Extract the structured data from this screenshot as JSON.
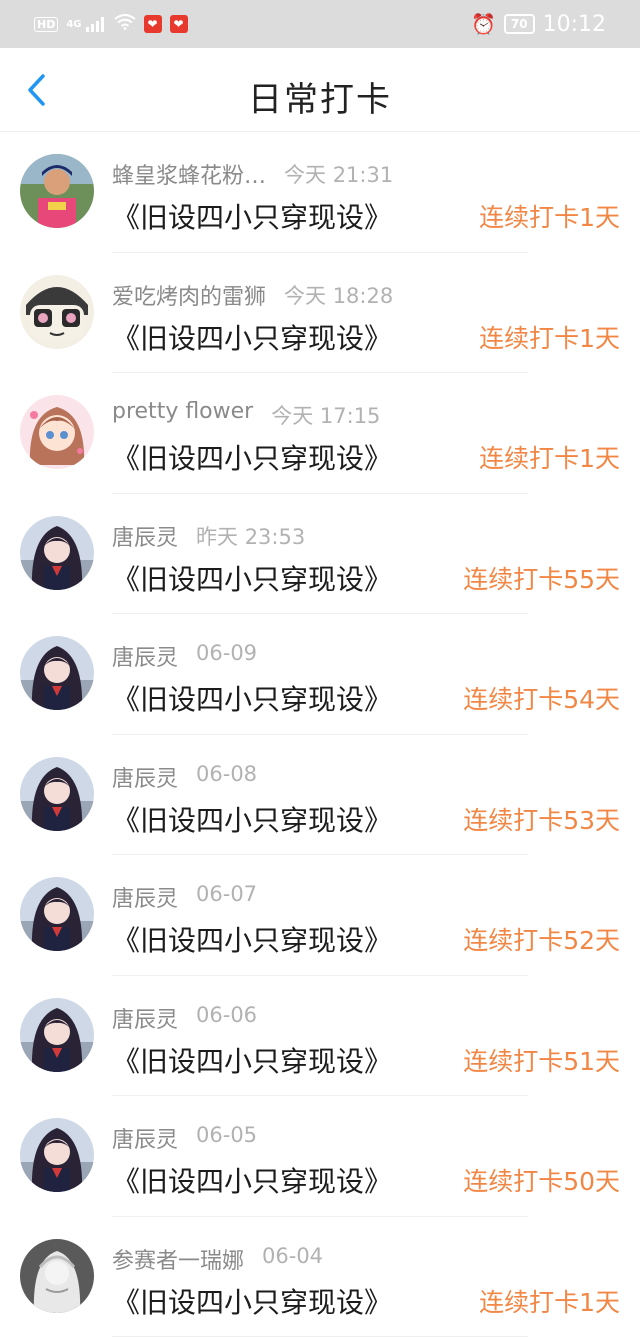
{
  "status_bar": {
    "hd_label": "HD",
    "network_label": "4G",
    "battery": "70",
    "time": "10:12"
  },
  "header": {
    "title": "日常打卡"
  },
  "entries": [
    {
      "user": "蜂皇浆蜂花粉…",
      "time": "今天 21:31",
      "book": "《旧设四小只穿现设》",
      "streak": "连续打卡1天",
      "avatar": "photo-person"
    },
    {
      "user": "爱吃烤肉的雷狮",
      "time": "今天 18:28",
      "book": "《旧设四小只穿现设》",
      "streak": "连续打卡1天",
      "avatar": "cartoon-face"
    },
    {
      "user": "pretty flower",
      "time": "今天 17:15",
      "book": "《旧设四小只穿现设》",
      "streak": "连续打卡1天",
      "avatar": "anime-pink"
    },
    {
      "user": "唐辰灵",
      "time": "昨天 23:53",
      "book": "《旧设四小只穿现设》",
      "streak": "连续打卡55天",
      "avatar": "anime-dark"
    },
    {
      "user": "唐辰灵",
      "time": "06-09",
      "book": "《旧设四小只穿现设》",
      "streak": "连续打卡54天",
      "avatar": "anime-dark"
    },
    {
      "user": "唐辰灵",
      "time": "06-08",
      "book": "《旧设四小只穿现设》",
      "streak": "连续打卡53天",
      "avatar": "anime-dark"
    },
    {
      "user": "唐辰灵",
      "time": "06-07",
      "book": "《旧设四小只穿现设》",
      "streak": "连续打卡52天",
      "avatar": "anime-dark"
    },
    {
      "user": "唐辰灵",
      "time": "06-06",
      "book": "《旧设四小只穿现设》",
      "streak": "连续打卡51天",
      "avatar": "anime-dark"
    },
    {
      "user": "唐辰灵",
      "time": "06-05",
      "book": "《旧设四小只穿现设》",
      "streak": "连续打卡50天",
      "avatar": "anime-dark"
    },
    {
      "user": "参赛者一瑞娜",
      "time": "06-04",
      "book": "《旧设四小只穿现设》",
      "streak": "连续打卡1天",
      "avatar": "sketch-gray"
    }
  ],
  "colors": {
    "streak": "#f28745",
    "back_arrow": "#2196f3"
  }
}
